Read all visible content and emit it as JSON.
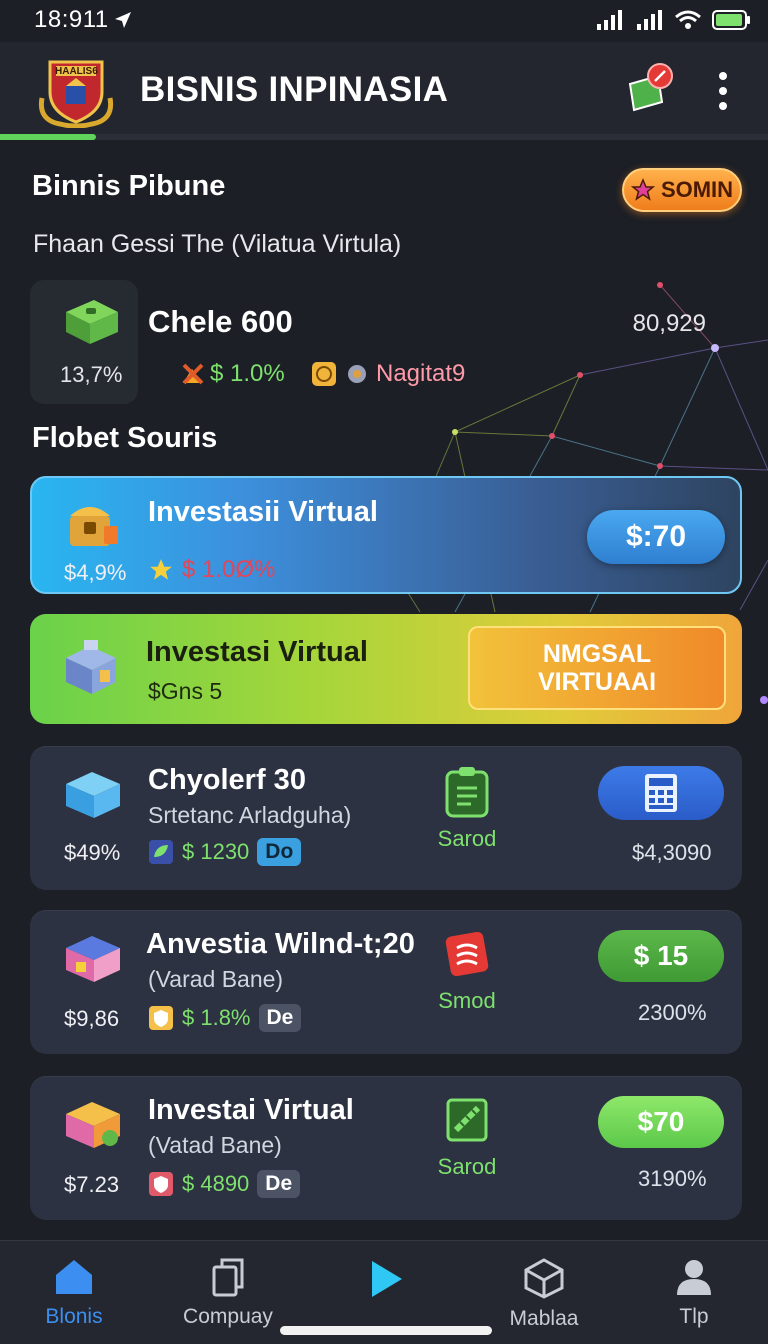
{
  "status_bar": {
    "time": "18:911"
  },
  "header": {
    "title": "BISNIS INPINASIA",
    "logo_text": "HAALIS6",
    "progress": 0.125
  },
  "section1": {
    "title": "Binnis Pibune",
    "subtitle": "Fhaan Gessi The (Vilatua Virtula)",
    "action_label": "SOMIN"
  },
  "summary": {
    "name": "Chele 600",
    "value": "80,929",
    "percent": "13,7%",
    "change": "$ 1.0%",
    "tag": "Nagitat9"
  },
  "section2": {
    "title": "Flobet Souris"
  },
  "cards": [
    {
      "title": "Investasii Virtual",
      "percent": "$4,9%",
      "change": "$ 1.0Ø%",
      "button": "$:70"
    },
    {
      "title": "Investasi Virtual",
      "subtitle": "$Gns 5",
      "button": "NMGSAL VIRTUAAI"
    },
    {
      "title": "Chyolerf 30",
      "subtitle": "Srtetanc Arladguha)",
      "percent": "$49%",
      "amount": "$ 1230",
      "badge": "Do",
      "action": "Sarod",
      "value": "$4,3090"
    },
    {
      "title": "Anvestia Wilnd-t;20",
      "subtitle": "(Varad Bane)",
      "percent": "$9,86",
      "amount": "$ 1.8%",
      "badge": "De",
      "action": "Smod",
      "button": "$ 15",
      "value": "2300%"
    },
    {
      "title": "Investai Virtual",
      "subtitle": "(Vatad Bane)",
      "percent": "$7.23",
      "amount": "$ 4890",
      "badge": "De",
      "action": "Sarod",
      "button": "$70",
      "value": "3190%"
    }
  ],
  "nav": [
    {
      "label": "Blonis",
      "icon": "home-icon",
      "active": true
    },
    {
      "label": "Compuay",
      "icon": "copy-icon",
      "active": false
    },
    {
      "label": "",
      "icon": "play-icon",
      "active": false
    },
    {
      "label": "Mablaa",
      "icon": "cube-icon",
      "active": false
    },
    {
      "label": "Tlp",
      "icon": "person-icon",
      "active": false
    }
  ],
  "colors": {
    "accent_green": "#7ee06d",
    "accent_blue": "#3c8ef0",
    "background": "#1c1f26"
  }
}
